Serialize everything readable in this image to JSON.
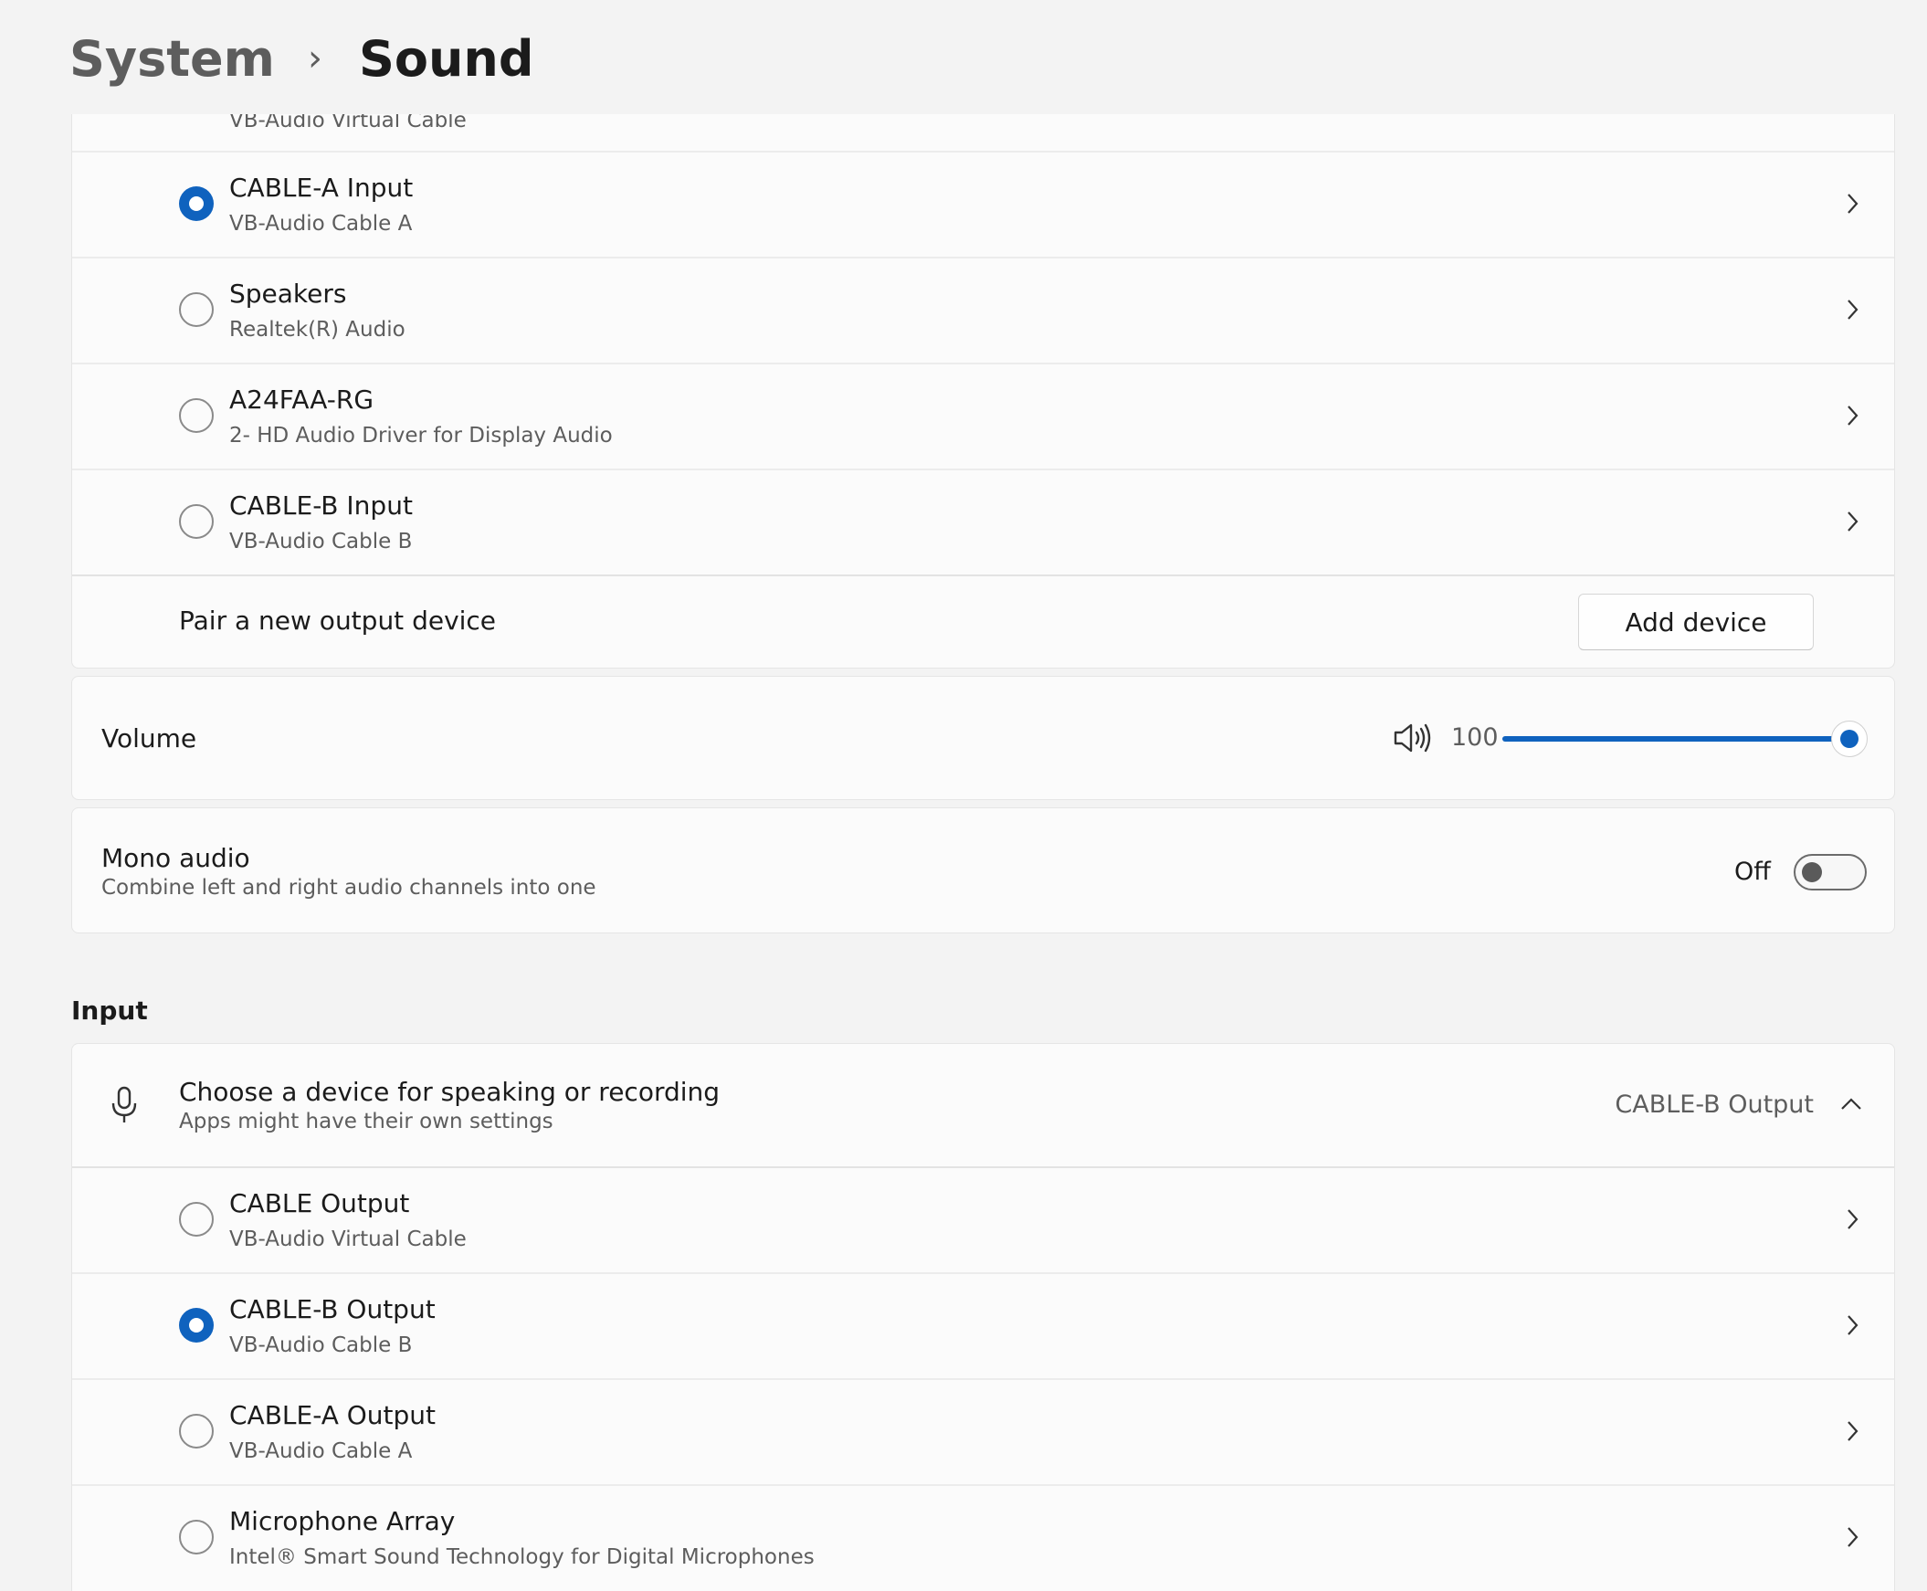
{
  "breadcrumb": {
    "parent": "System",
    "current": "Sound"
  },
  "output": {
    "top_partial_subtitle": "VB-Audio Virtual Cable",
    "devices": [
      {
        "name": "CABLE-A Input",
        "subtitle": "VB-Audio Cable A",
        "selected": true
      },
      {
        "name": "Speakers",
        "subtitle": "Realtek(R) Audio",
        "selected": false
      },
      {
        "name": "A24FAA-RG",
        "subtitle": "2- HD Audio Driver for Display Audio",
        "selected": false
      },
      {
        "name": "CABLE-B Input",
        "subtitle": "VB-Audio Cable B",
        "selected": false
      }
    ],
    "pair_label": "Pair a new output device",
    "add_device_label": "Add device"
  },
  "volume": {
    "label": "Volume",
    "value": "100",
    "icon": "speaker-icon",
    "level_fraction": 1.0
  },
  "mono_audio": {
    "title": "Mono audio",
    "subtitle": "Combine left and right audio channels into one",
    "state_label": "Off",
    "enabled": false
  },
  "input": {
    "section_title": "Input",
    "chooser_title": "Choose a device for speaking or recording",
    "chooser_subtitle": "Apps might have their own settings",
    "selected_device": "CABLE-B Output",
    "icon": "microphone-icon",
    "devices": [
      {
        "name": "CABLE Output",
        "subtitle": "VB-Audio Virtual Cable",
        "selected": false
      },
      {
        "name": "CABLE-B Output",
        "subtitle": "VB-Audio Cable B",
        "selected": true
      },
      {
        "name": "CABLE-A Output",
        "subtitle": "VB-Audio Cable A",
        "selected": false
      },
      {
        "name": "Microphone Array",
        "subtitle": "Intel® Smart Sound Technology for Digital Microphones",
        "selected": false
      }
    ]
  },
  "colors": {
    "accent": "#0f62be",
    "background": "#f3f3f3",
    "card": "#fbfbfb"
  }
}
